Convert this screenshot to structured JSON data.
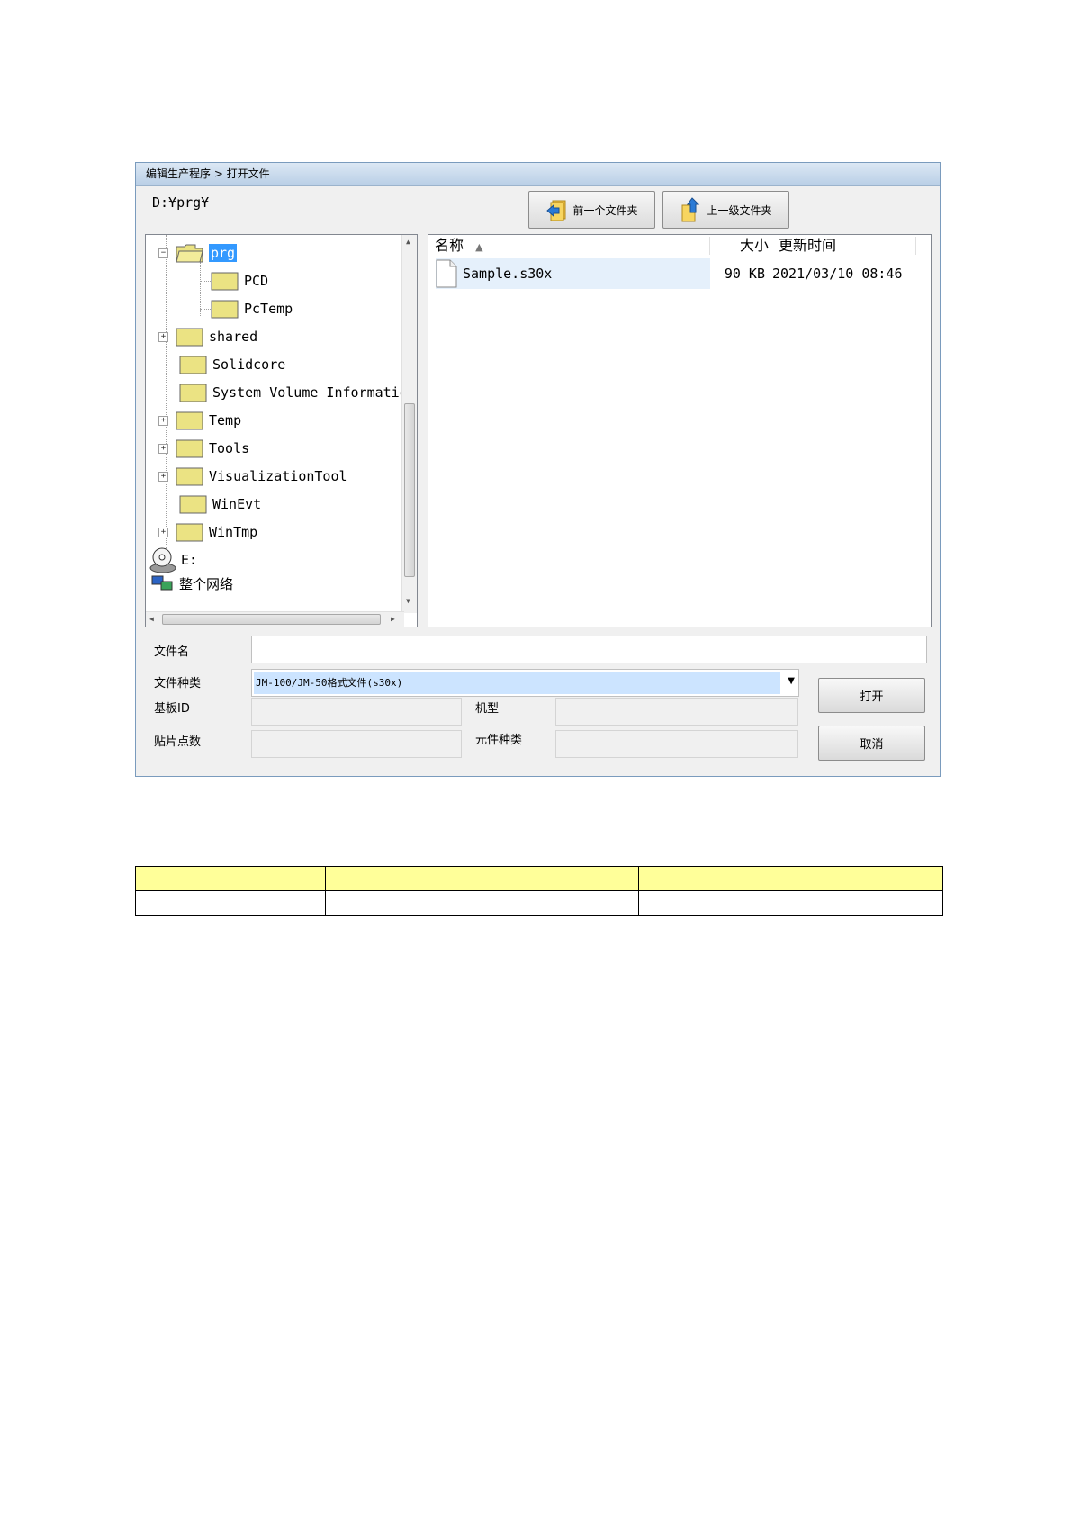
{
  "window": {
    "title": "编辑生产程序 > 打开文件"
  },
  "current_path": "D:¥prg¥",
  "toolbar": {
    "prev_folder_label": "前一个文件夹",
    "up_folder_label": "上一级文件夹"
  },
  "tree": {
    "items": [
      {
        "label": "prg",
        "expander": "minus",
        "selected": true
      },
      {
        "label": "PCD"
      },
      {
        "label": "PcTemp"
      },
      {
        "label": "shared",
        "expander": "plus"
      },
      {
        "label": "Solidcore"
      },
      {
        "label": "System Volume Information"
      },
      {
        "label": "Temp",
        "expander": "plus"
      },
      {
        "label": "Tools",
        "expander": "plus"
      },
      {
        "label": "VisualizationTool",
        "expander": "plus"
      },
      {
        "label": "WinEvt"
      },
      {
        "label": "WinTmp",
        "expander": "plus"
      },
      {
        "label": "E:",
        "icon": "cd-drive-icon"
      },
      {
        "label": "整个网络",
        "icon": "network-icon"
      }
    ]
  },
  "file_list": {
    "columns": {
      "name": "名称",
      "size": "大小",
      "modified": "更新时间"
    },
    "sort_indicator": "▲",
    "rows": [
      {
        "name": "Sample.s30x",
        "size": "90 KB",
        "modified": "2021/03/10 08:46"
      }
    ]
  },
  "form": {
    "filename_label": "文件名",
    "filename_value": "",
    "filetype_label": "文件种类",
    "filetype_value": "JM-100/JM-50格式文件(s30x)",
    "board_id_label": "基板ID",
    "machine_label": "机型",
    "placement_count_label": "贴片点数",
    "component_type_label": "元件种类"
  },
  "buttons": {
    "open": "打开",
    "cancel": "取消"
  },
  "table": {
    "header_color": "#ffff99",
    "rows": [
      [
        "",
        "",
        ""
      ],
      [
        "",
        "",
        ""
      ]
    ]
  }
}
